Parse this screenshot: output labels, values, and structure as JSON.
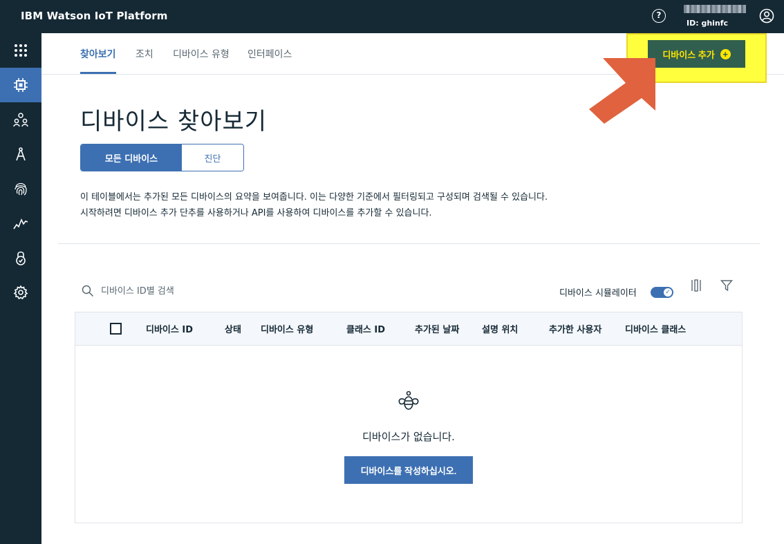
{
  "header": {
    "brand": "IBM Watson IoT Platform",
    "help_glyph": "?",
    "account_id": "ID: ghinfc"
  },
  "sidebar": {
    "items": [
      {
        "icon": "apps-grid-icon",
        "active": false
      },
      {
        "icon": "chip-icon",
        "active": true
      },
      {
        "icon": "members-icon",
        "active": false
      },
      {
        "icon": "compass-icon",
        "active": false
      },
      {
        "icon": "fingerprint-icon",
        "active": false
      },
      {
        "icon": "usage-chart-icon",
        "active": false
      },
      {
        "icon": "lock-icon",
        "active": false
      },
      {
        "icon": "settings-gear-icon",
        "active": false
      }
    ]
  },
  "tabs": [
    {
      "label": "찾아보기",
      "active": true
    },
    {
      "label": "조치",
      "active": false
    },
    {
      "label": "디바이스 유형",
      "active": false
    },
    {
      "label": "인터페이스",
      "active": false
    }
  ],
  "add_device_button": {
    "label": "디바이스 추가",
    "icon": "plus-circle-icon"
  },
  "page": {
    "title": "디바이스 찾아보기",
    "segments": {
      "all": "모든 디바이스",
      "diagnose": "진단"
    },
    "description_line1": "이 테이블에서는 추가된 모든 디바이스의 요약을 보여줍니다. 이는 다양한 기준에서 필터링되고 구성되며 검색될 수 있습니다.",
    "description_line2": "시작하려면 디바이스 추가 단추를 사용하거나 API를 사용하여 디바이스를 추가할 수 있습니다."
  },
  "toolbar": {
    "search_placeholder": "디바이스 ID별 검색",
    "simulator_label": "디바이스 시뮬레이터",
    "simulator_on": true
  },
  "table": {
    "columns": [
      "디바이스 ID",
      "상태",
      "디바이스 유형",
      "클래스 ID",
      "추가된 날짜",
      "설명 위치",
      "추가한 사용자",
      "디바이스 클래스"
    ],
    "rows": [],
    "empty_message": "디바이스가 없습니다.",
    "create_button": "디바이스를 작성하십시오."
  },
  "colors": {
    "nav_bg": "#152935",
    "accent": "#3d70b2",
    "add_button_bg": "#315f4f",
    "highlight": "#ffff3d",
    "arrow": "#e0623f"
  }
}
